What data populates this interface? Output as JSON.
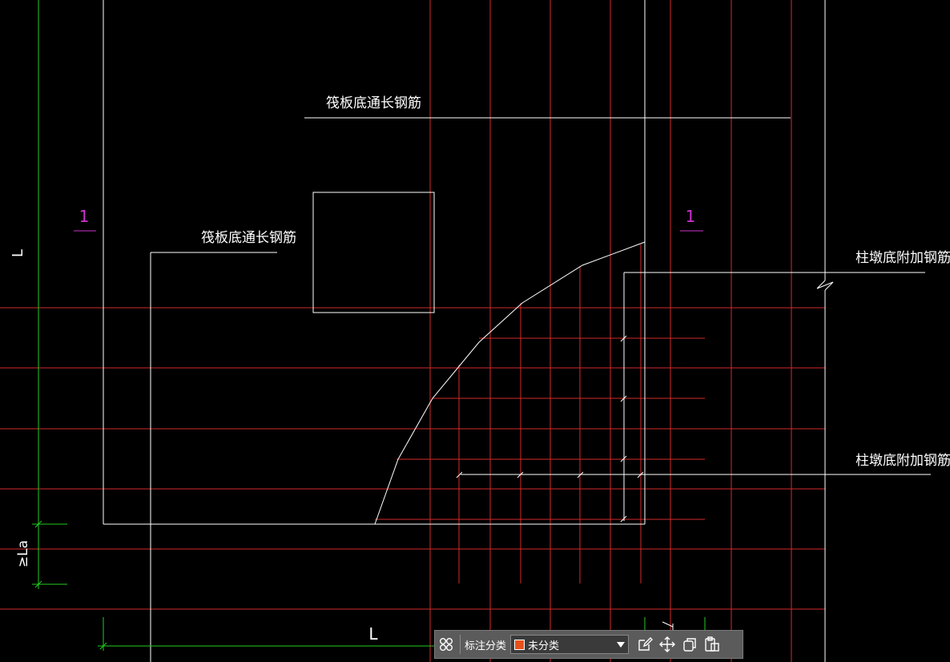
{
  "drawing": {
    "labels": {
      "raft_bottom_top": "筏板底通长钢筋",
      "raft_bottom_left": "筏板底通长钢筋",
      "column_pier_upper": "柱墩底附加钢筋",
      "column_pier_lower": "柱墩底附加钢筋",
      "section_mark_left": "1",
      "section_mark_right": "1",
      "dim_L_vertical": "L",
      "dim_la": "≥La",
      "dim_L_horizontal": "L"
    },
    "colors": {
      "background": "#000000",
      "outline": "#ffffff",
      "rebar": "#d42a2a",
      "dimension": "#22cc22",
      "section_mark": "#cc33cc"
    }
  },
  "toolbar": {
    "annotation_class_label": "标注分类",
    "category_value": "未分类",
    "category_color": "#e8521a",
    "icons": [
      "grid-icon",
      "edit-icon",
      "move-icon",
      "copy-icon",
      "paste-icon"
    ]
  }
}
